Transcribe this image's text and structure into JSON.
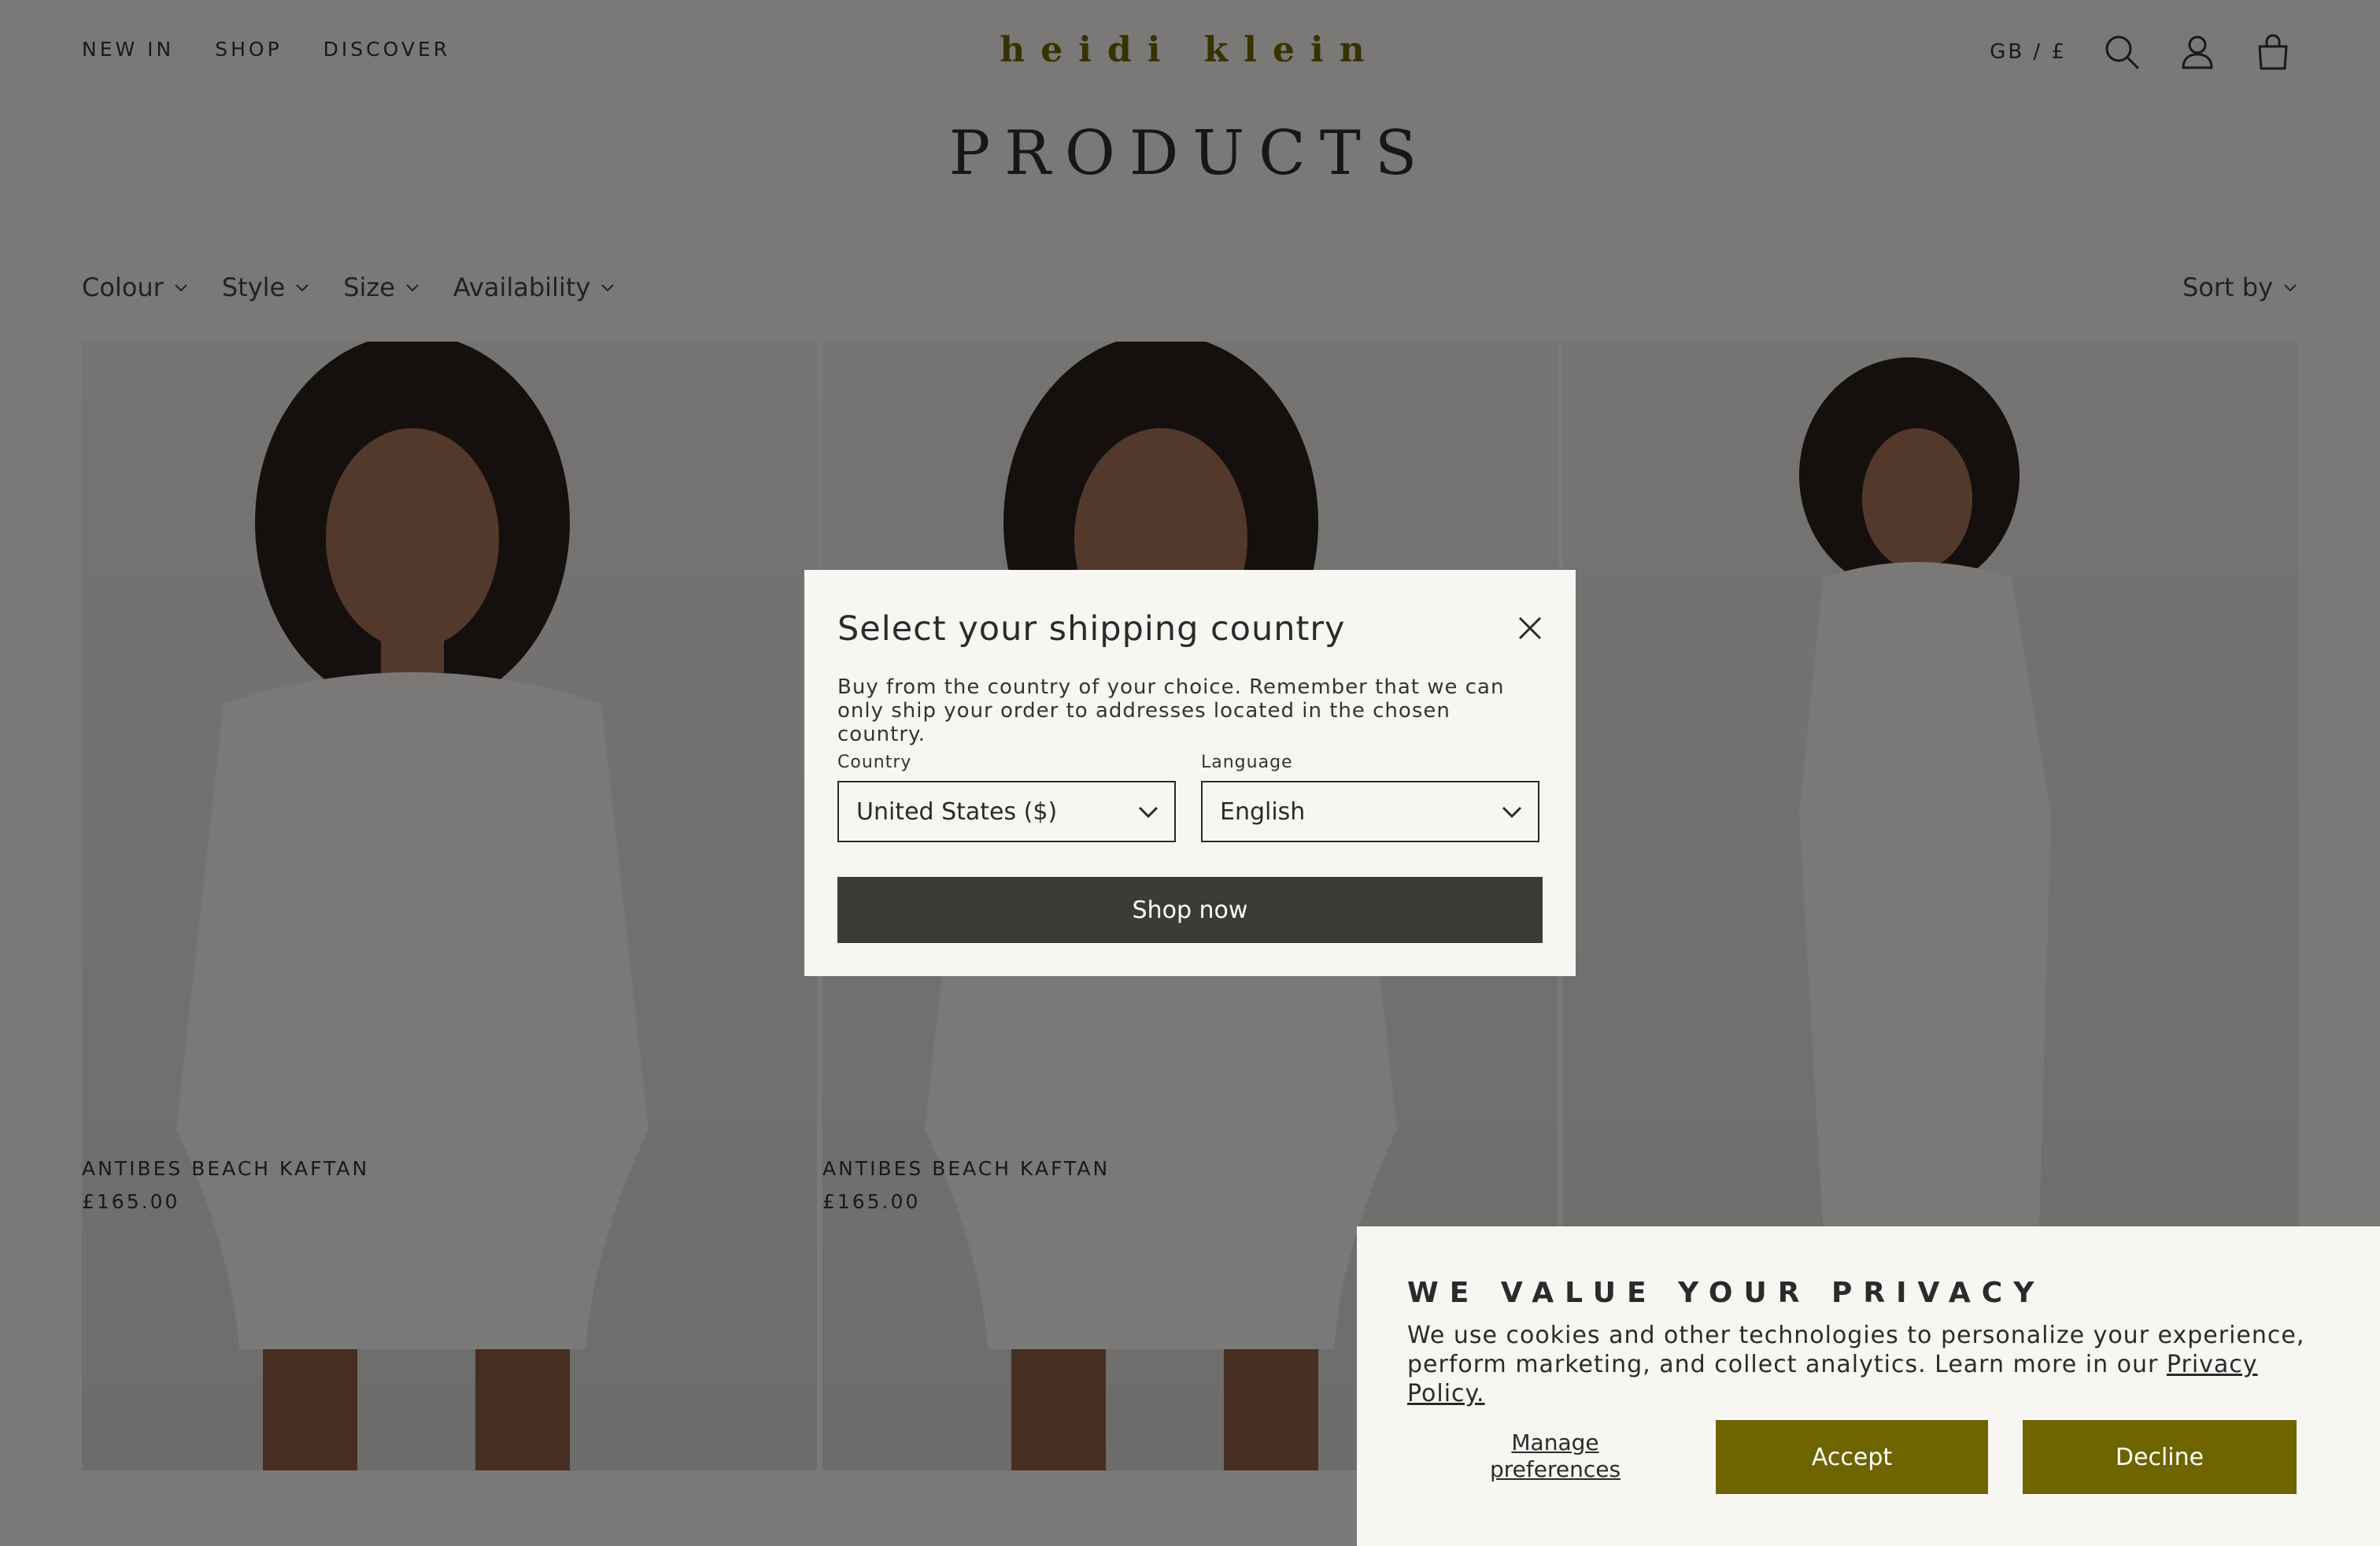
{
  "header": {
    "nav": [
      "NEW IN",
      "SHOP",
      "DISCOVER"
    ],
    "logo": "heidi klein",
    "locale": "GB / £",
    "icons": [
      "search-icon",
      "account-icon",
      "bag-icon"
    ]
  },
  "page": {
    "title": "PRODUCTS"
  },
  "filters": [
    "Colour",
    "Style",
    "Size",
    "Availability"
  ],
  "sort_label": "Sort by",
  "products": [
    {
      "name": "ANTIBES BEACH KAFTAN",
      "price": "£165.00"
    },
    {
      "name": "ANTIBES BEACH KAFTAN",
      "price": "£165.00"
    },
    {
      "name": "",
      "price": ""
    }
  ],
  "modal": {
    "title": "Select your shipping country",
    "text": "Buy from the country of your choice. Remember that we can only ship your order to addresses located in the chosen country.",
    "country_label": "Country",
    "country_value": "United States ($)",
    "language_label": "Language",
    "language_value": "English",
    "shop_now": "Shop now"
  },
  "cookie": {
    "title": "WE VALUE YOUR PRIVACY",
    "text": "We use cookies and other technologies to personalize your experience, perform marketing, and collect analytics. Learn more in our ",
    "link": "Privacy Policy.",
    "manage": "Manage preferences",
    "accept": "Accept",
    "decline": "Decline"
  },
  "colors": {
    "brand": "#6e6400",
    "dark_button": "#3b3c35",
    "overlay": "rgba(0,0,0,0.5)"
  }
}
